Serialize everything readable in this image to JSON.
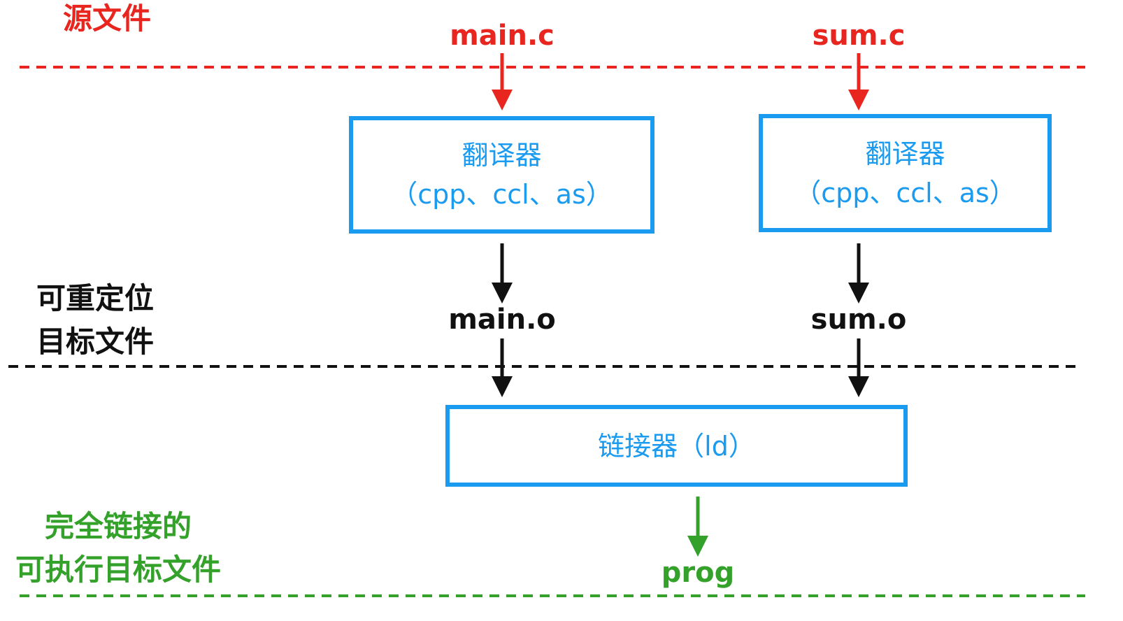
{
  "levels": {
    "source": "源文件",
    "relocatable_line1": "可重定位",
    "relocatable_line2": "目标文件",
    "executable_line1": "完全链接的",
    "executable_line2": "可执行目标文件"
  },
  "files": {
    "main_c": "main.c",
    "sum_c": "sum.c",
    "main_o": "main.o",
    "sum_o": "sum.o",
    "prog": "prog"
  },
  "translator_left": {
    "title": "翻译器",
    "tools": "（cpp、ccl、as）"
  },
  "translator_right": {
    "title": "翻译器",
    "tools": "（cpp、ccl、as）"
  },
  "linker": {
    "label": "链接器（ld）"
  },
  "colors": {
    "source": "#e8261f",
    "relocatable": "#111111",
    "executable": "#33a12a",
    "tool_box": "#1a9bf0"
  }
}
